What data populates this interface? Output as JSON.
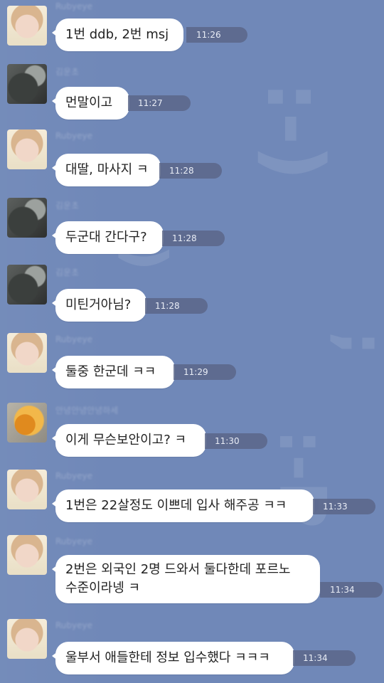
{
  "chat": {
    "messages": [
      {
        "sender": "Rubyeye",
        "text": "1번 ddb, 2번 msj",
        "time": "11:26"
      },
      {
        "sender": "김운초",
        "text": "먼말이고",
        "time": "11:27"
      },
      {
        "sender": "Rubyeye",
        "text": "대딸, 마사지 ㅋ",
        "time": "11:28"
      },
      {
        "sender": "김운초",
        "text": "두군대 간다구?",
        "time": "11:28"
      },
      {
        "sender": "김운초",
        "text": "미틴거아님?",
        "time": "11:28"
      },
      {
        "sender": "Rubyeye",
        "text": "둘중 한군데 ㅋㅋ",
        "time": "11:29"
      },
      {
        "sender": "안녕안녕안녕하세",
        "text": "이게 무슨보안이고? ㅋ",
        "time": "11:30"
      },
      {
        "sender": "Rubyeye",
        "text": "1번은 22살정도 이쁘데 입사 해주공 ㅋㅋ",
        "time": "11:33"
      },
      {
        "sender": "Rubyeye",
        "text": "2번은 외국인 2명 드와서 둘다한데 포르노\n수준이라넹 ㅋ",
        "time": "11:34"
      },
      {
        "sender": "Rubyeye",
        "text": "울부서 애들한테 정보 입수했다 ㅋㅋㅋ",
        "time": "11:34"
      }
    ]
  }
}
